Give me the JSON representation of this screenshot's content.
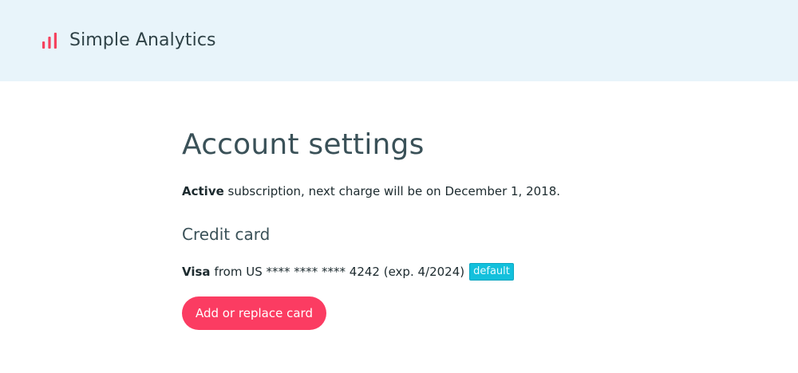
{
  "header": {
    "brand_name": "Simple Analytics",
    "logo_icon": "bar-chart-icon",
    "logo_color": "#f5425e",
    "background": "#e8f4fa"
  },
  "main": {
    "title": "Account settings",
    "subscription": {
      "status": "Active",
      "text": "subscription, next charge will be on December 1, 2018."
    },
    "credit_card": {
      "section_title": "Credit card",
      "brand": "Visa",
      "details": "from US **** **** **** 4242 (exp. 4/2024)",
      "badge": "default",
      "badge_color": "#13c0dc"
    },
    "button": {
      "label": "Add or replace card",
      "color": "#fb3c62"
    }
  }
}
